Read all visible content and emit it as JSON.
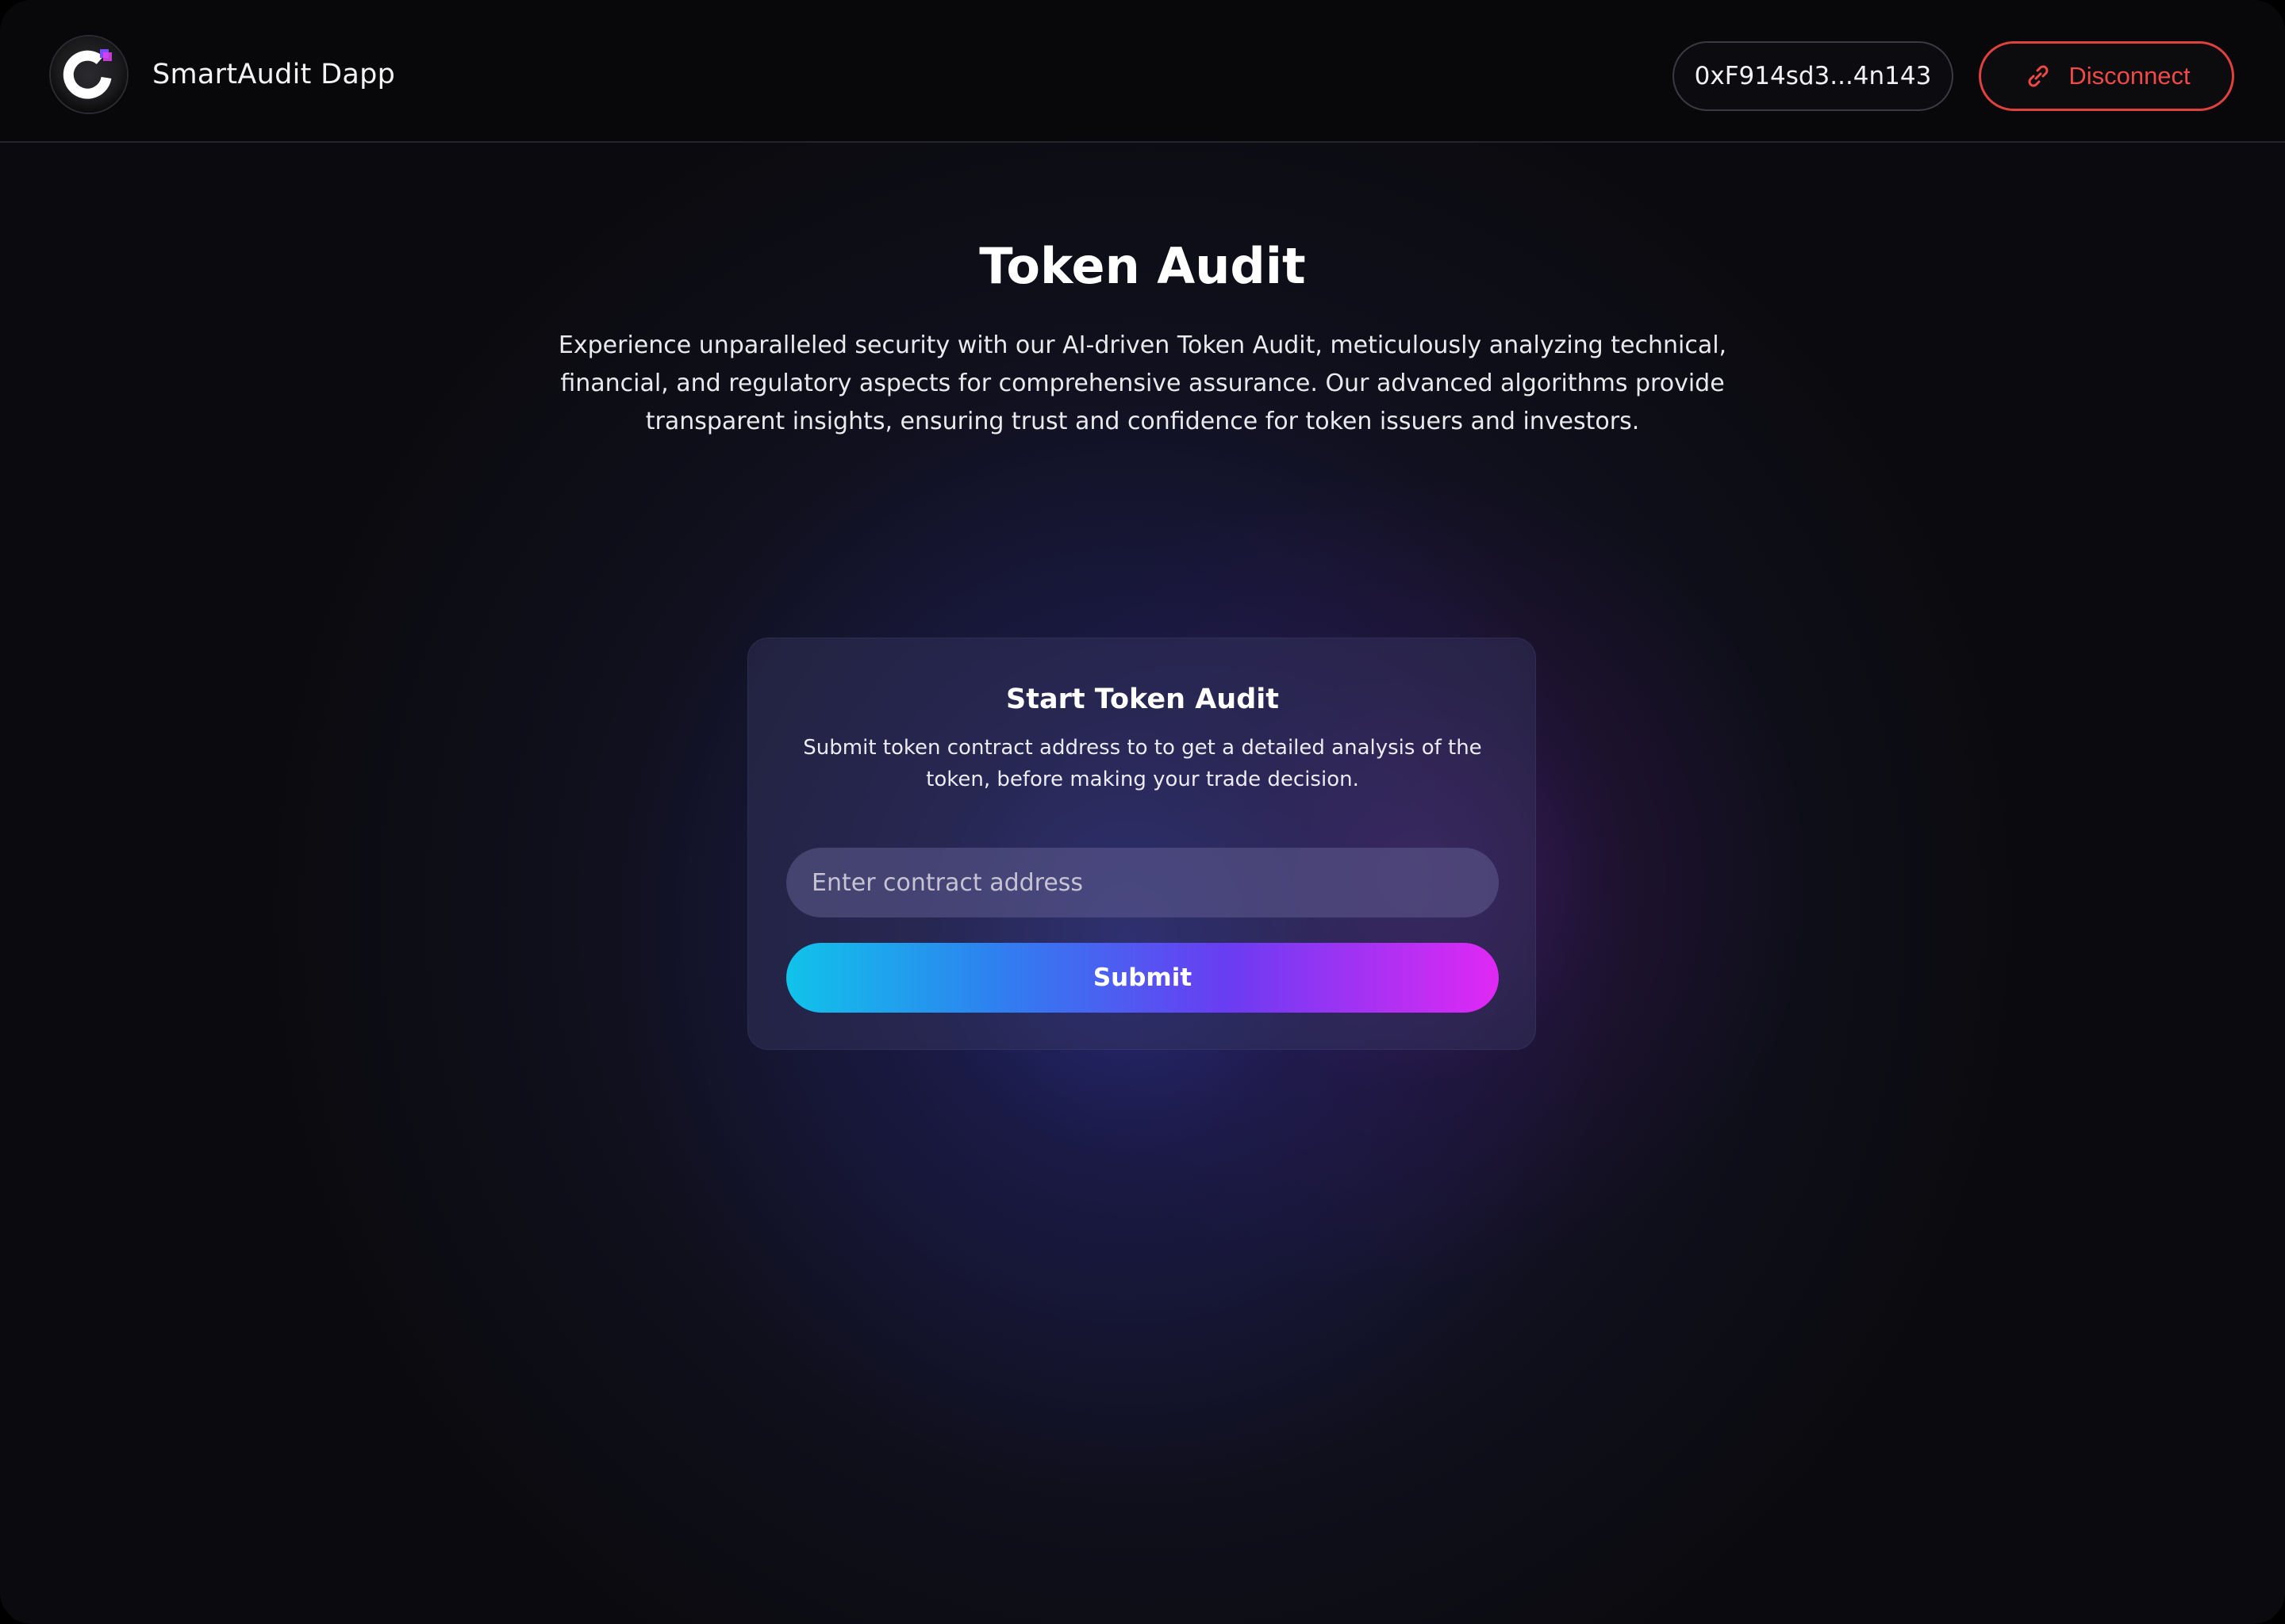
{
  "header": {
    "brand_name": "SmartAudit Dapp",
    "logo_icon": "smartaudit-logo-icon",
    "wallet_address": "0xF914sd3...4n143",
    "disconnect_label": "Disconnect",
    "disconnect_icon": "link-icon"
  },
  "hero": {
    "title": "Token Audit",
    "description": "Experience unparalleled security with our AI-driven Token Audit, meticulously analyzing technical, financial, and regulatory aspects for comprehensive assurance. Our advanced algorithms provide transparent insights, ensuring trust and confidence for token issuers and investors."
  },
  "audit_card": {
    "title": "Start Token Audit",
    "description": "Submit token contract address to to get a detailed analysis of the token, before making your trade decision.",
    "input_placeholder": "Enter contract address",
    "input_value": "",
    "submit_label": "Submit"
  },
  "colors": {
    "background": "#0b0b0f",
    "disconnect_red": "#ef4a45",
    "gradient_start": "#10c3ea",
    "gradient_end": "#e028f4"
  }
}
